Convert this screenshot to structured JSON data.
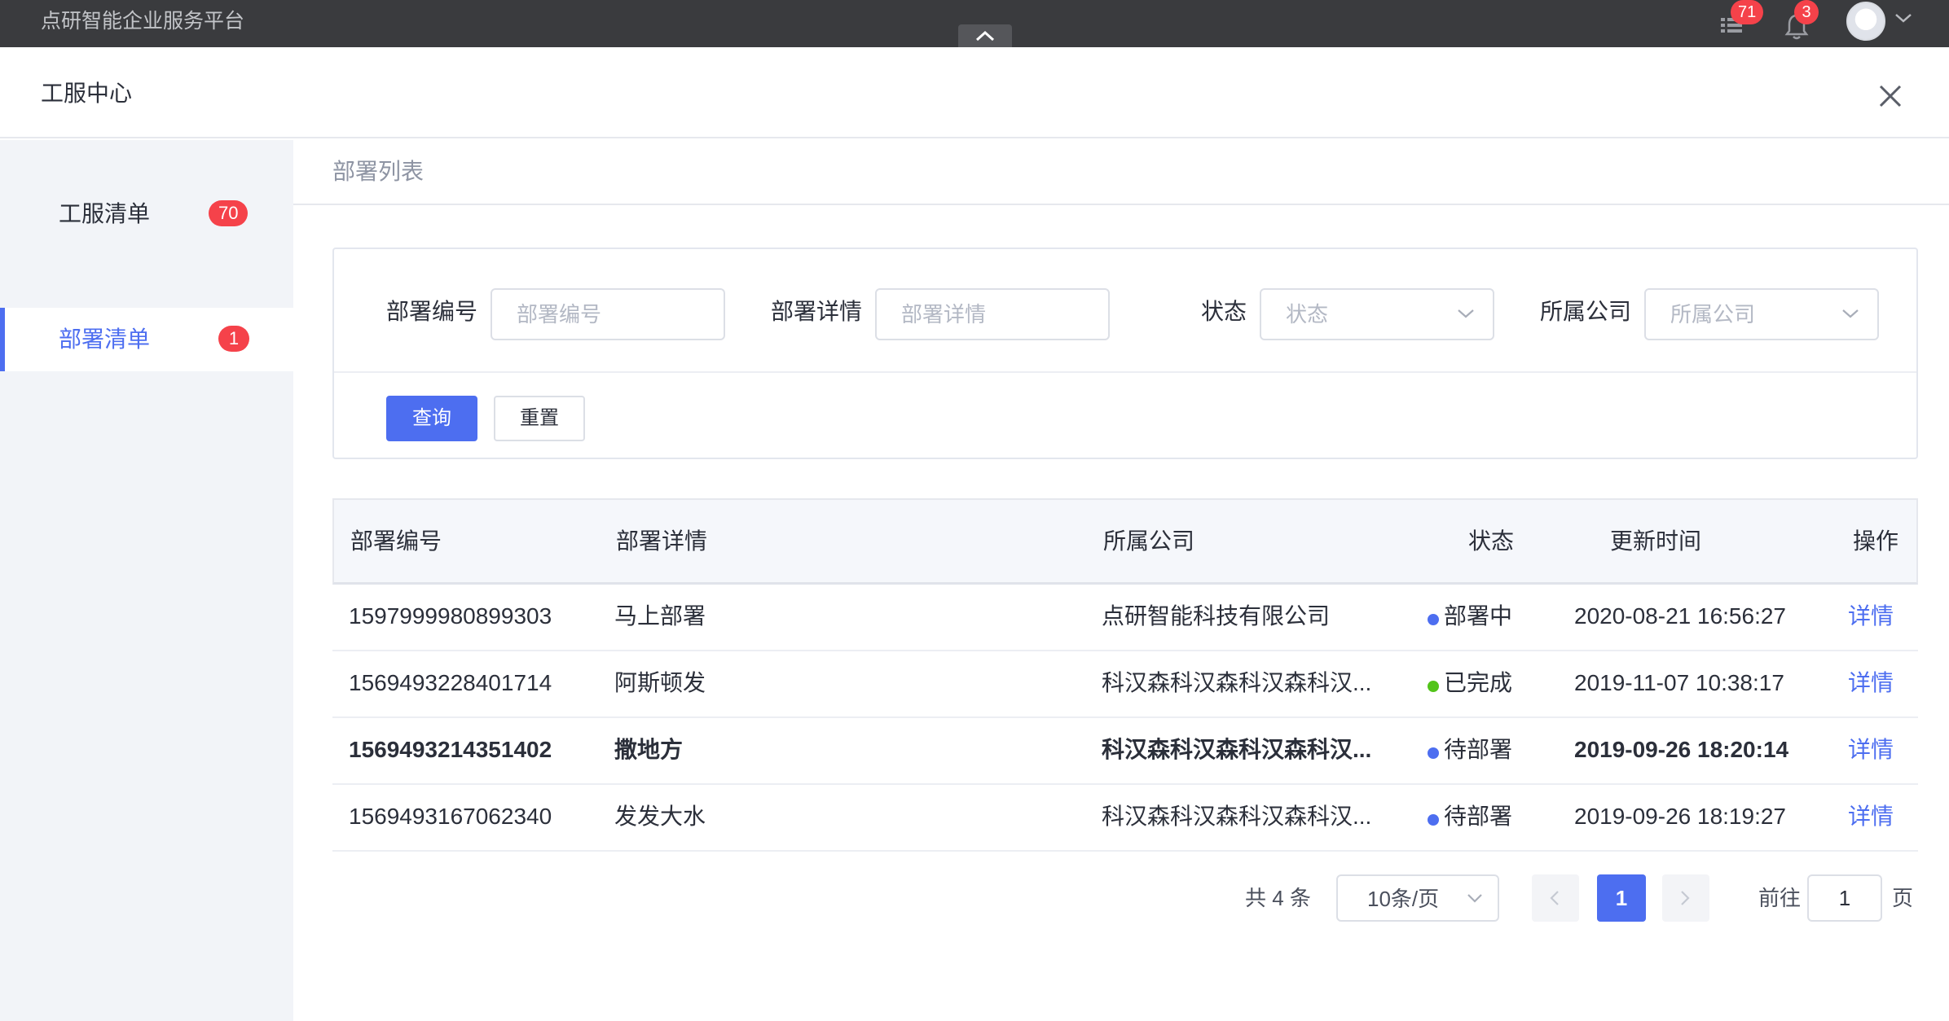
{
  "topbar": {
    "app_title": "点研智能企业服务平台",
    "tasks_badge": "71",
    "notifications_badge": "3"
  },
  "dialog": {
    "title": "工服中心"
  },
  "sidebar": {
    "items": [
      {
        "label": "工服清单",
        "count": "70",
        "active": false
      },
      {
        "label": "部署清单",
        "count": "1",
        "active": true
      }
    ]
  },
  "breadcrumb": "部署列表",
  "filters": {
    "deploy_no": {
      "label": "部署编号",
      "placeholder": "部署编号"
    },
    "deploy_detail": {
      "label": "部署详情",
      "placeholder": "部署详情"
    },
    "status": {
      "label": "状态",
      "placeholder": "状态"
    },
    "company": {
      "label": "所属公司",
      "placeholder": "所属公司"
    },
    "query_button": "查询",
    "reset_button": "重置"
  },
  "table": {
    "columns": [
      "部署编号",
      "部署详情",
      "所属公司",
      "状态",
      "更新时间",
      "操作"
    ],
    "rows": [
      {
        "id": "1597999980899303",
        "detail": "马上部署",
        "company": "点研智能科技有限公司",
        "status": "部署中",
        "status_color": "#4d6ef0",
        "updated": "2020-08-21 16:56:27",
        "action": "详情",
        "bold": false
      },
      {
        "id": "1569493228401714",
        "detail": "阿斯顿发",
        "company": "科汉森科汉森科汉森科汉...",
        "status": "已完成",
        "status_color": "#52c41a",
        "updated": "2019-11-07 10:38:17",
        "action": "详情",
        "bold": false
      },
      {
        "id": "1569493214351402",
        "detail": "撒地方",
        "company": "科汉森科汉森科汉森科汉...",
        "status": "待部署",
        "status_color": "#4d6ef0",
        "updated": "2019-09-26 18:20:14",
        "action": "详情",
        "bold": true
      },
      {
        "id": "1569493167062340",
        "detail": "发发大水",
        "company": "科汉森科汉森科汉森科汉...",
        "status": "待部署",
        "status_color": "#4d6ef0",
        "updated": "2019-09-26 18:19:27",
        "action": "详情",
        "bold": false
      }
    ]
  },
  "pagination": {
    "total_text": "共 4 条",
    "page_size": "10条/页",
    "current_page": "1",
    "goto_label": "前往",
    "goto_value": "1",
    "page_suffix": "页"
  }
}
